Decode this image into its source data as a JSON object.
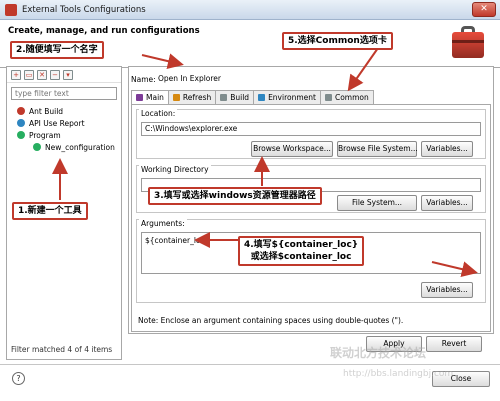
{
  "window": {
    "title": "External Tools Configurations"
  },
  "header": {
    "heading": "Create, manage, and run configurations"
  },
  "left": {
    "filter_placeholder": "type filter text",
    "tree": [
      {
        "label": "Ant Build",
        "color": "#c0392b"
      },
      {
        "label": "API Use Report",
        "color": "#2e86c1"
      },
      {
        "label": "Program",
        "color": "#27ae60"
      },
      {
        "label": "New_configuration",
        "color": "#27ae60"
      }
    ],
    "status": "Filter matched 4 of 4 items"
  },
  "main": {
    "name_label": "Name:",
    "name_value": "Open In Explorer",
    "tabs": [
      {
        "label": "Main",
        "active": true,
        "color": "#7d3c98"
      },
      {
        "label": "Refresh",
        "active": false,
        "color": "#d68910"
      },
      {
        "label": "Build",
        "active": false,
        "color": "#7f8c8d"
      },
      {
        "label": "Environment",
        "active": false,
        "color": "#2e86c1"
      },
      {
        "label": "Common",
        "active": false,
        "color": "#7f8c8d"
      }
    ],
    "location": {
      "label": "Location:",
      "value": "C:\\Windows\\explorer.exe",
      "btn_workspace": "Browse Workspace...",
      "btn_filesystem": "Browse File System...",
      "btn_variables": "Variables..."
    },
    "workdir": {
      "label": "Working Directory",
      "btn_filesystem": "File System...",
      "btn_variables": "Variables..."
    },
    "arguments": {
      "label": "Arguments:",
      "value": "${container_loc}",
      "btn_variables": "Variables..."
    },
    "note": "Note: Enclose an argument containing spaces using double-quotes (\")."
  },
  "buttons": {
    "apply": "Apply",
    "revert": "Revert",
    "close": "Close"
  },
  "callouts": {
    "c1": "1.新建一个工具",
    "c2": "2.随便填写一个名字",
    "c3": "3.填写或选择windows资源管理器路径",
    "c4a": "4.填写${container_loc}",
    "c4b": "或选择$container_loc",
    "c5": "5.选择Common选项卡"
  },
  "watermark": {
    "line1": "联动北方技术论坛",
    "line2": "http://bbs.landingbj.com"
  }
}
